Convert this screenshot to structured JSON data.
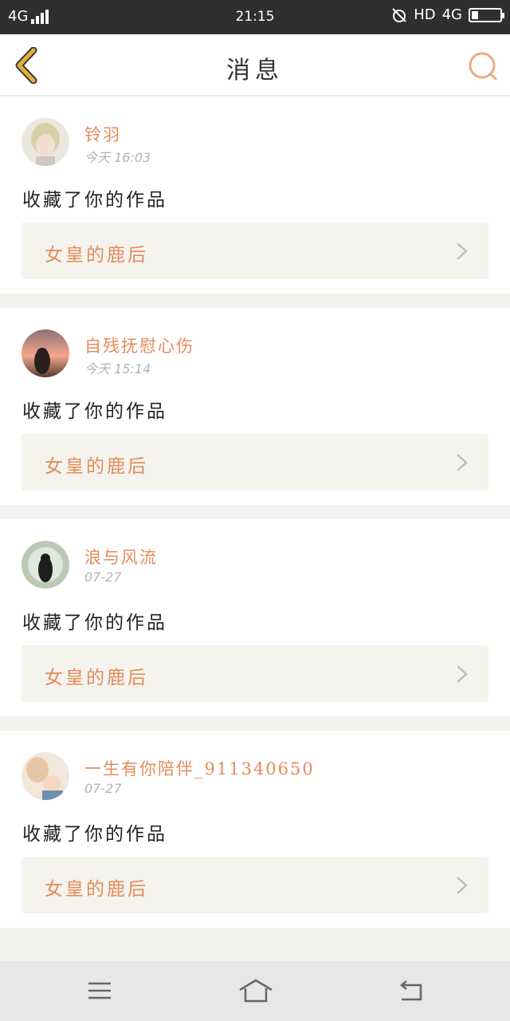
{
  "status_bar": {
    "network_left": "4G",
    "time": "21:15",
    "hd": "HD",
    "network_right": "4G"
  },
  "header": {
    "title": "消息"
  },
  "messages": [
    {
      "user": "铃羽",
      "time": "今天 16:03",
      "action": "收藏了你的作品",
      "work_title": "女皇的鹿后",
      "avatar": "avatar-blonde"
    },
    {
      "user": "自残抚慰心伤",
      "time": "今天 15:14",
      "action": "收藏了你的作品",
      "work_title": "女皇的鹿后",
      "avatar": "avatar-sunset"
    },
    {
      "user": "浪与风流",
      "time": "07-27",
      "action": "收藏了你的作品",
      "work_title": "女皇的鹿后",
      "avatar": "avatar-green"
    },
    {
      "user": "一生有你陪伴_911340650",
      "time": "07-27",
      "action": "收藏了你的作品",
      "work_title": "女皇的鹿后",
      "avatar": "avatar-child"
    }
  ],
  "colors": {
    "accent": "#e48b5a",
    "chevron": "#e0b03a",
    "status_bg": "#2f2f2f"
  }
}
